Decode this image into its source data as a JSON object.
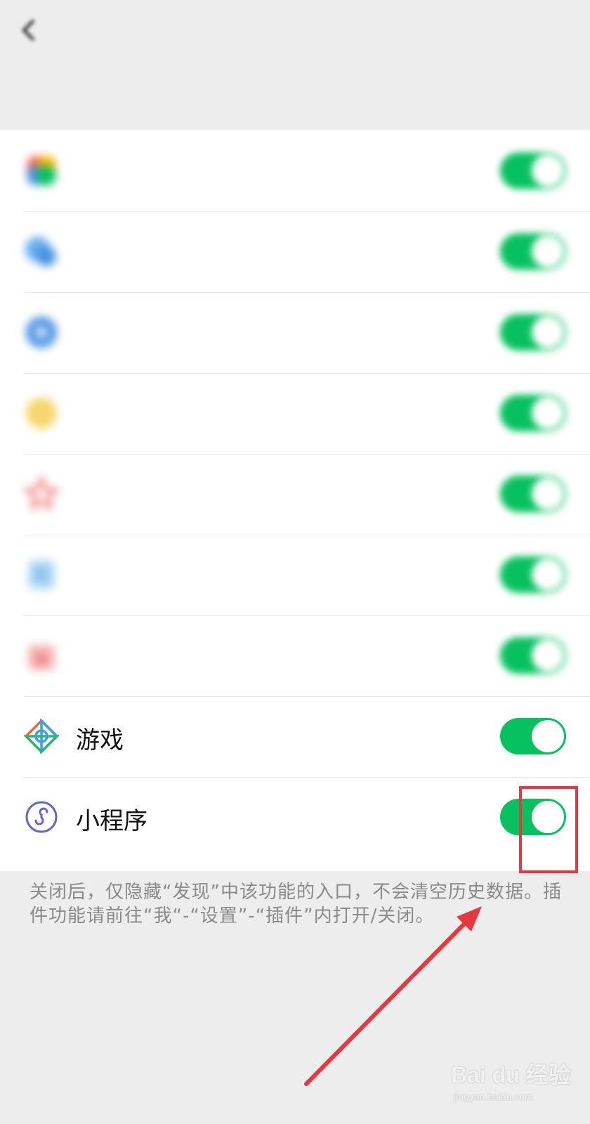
{
  "header": {
    "back_icon": "chevron-left-icon",
    "title": ""
  },
  "section_hint": "",
  "items": [
    {
      "label": "",
      "icon": "moments-icon",
      "icon_color": "#f4b400",
      "enabled": true,
      "blurred": true
    },
    {
      "label": "",
      "icon": "scan-icon",
      "icon_color": "#4a90e2",
      "enabled": true,
      "blurred": true
    },
    {
      "label": "",
      "icon": "shake-icon",
      "icon_color": "#4a90e2",
      "enabled": true,
      "blurred": true
    },
    {
      "label": "",
      "icon": "top-stories-icon",
      "icon_color": "#f5d76e",
      "enabled": true,
      "blurred": true
    },
    {
      "label": "",
      "icon": "search-icon",
      "icon_color": "#f06a6a",
      "enabled": true,
      "blurred": true
    },
    {
      "label": "",
      "icon": "people-nearby-icon",
      "icon_color": "#8ec5f0",
      "enabled": true,
      "blurred": true
    },
    {
      "label": "",
      "icon": "shopping-icon",
      "icon_color": "#f08a8a",
      "enabled": true,
      "blurred": true
    },
    {
      "label": "游戏",
      "icon": "games-icon",
      "icon_color": "#e8663d",
      "enabled": true,
      "blurred": false
    },
    {
      "label": "小程序",
      "icon": "mini-programs-icon",
      "icon_color": "#6467c8",
      "enabled": true,
      "blurred": false
    }
  ],
  "footnote": "关闭后，仅隐藏“发现”中该功能的入口，不会清空历史数据。插件功能请前往“我“-“设置”-“插件”内打开/关闭。",
  "annotation": {
    "highlight_color": "#e5393f"
  },
  "watermark": {
    "brand": "Bai du 经验",
    "url": "jingyan.baidu.com"
  }
}
